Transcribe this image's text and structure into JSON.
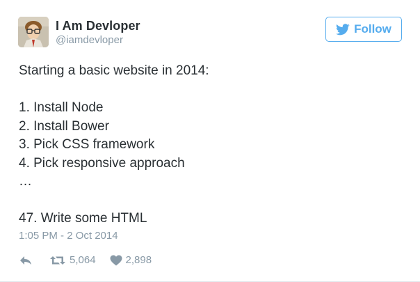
{
  "user": {
    "display_name": "I Am Devloper",
    "handle": "@iamdevloper"
  },
  "follow_button": {
    "label": "Follow",
    "icon": "twitter-bird-icon",
    "color": "#55acee"
  },
  "tweet": {
    "lines": [
      "Starting a basic website in 2014:",
      "",
      "1. Install Node",
      "2. Install Bower",
      "3. Pick CSS framework",
      "4. Pick responsive approach",
      "…",
      "",
      "47. Write some HTML"
    ],
    "timestamp": "1:05 PM - 2 Oct 2014"
  },
  "actions": {
    "reply_icon": "reply-icon",
    "retweet_icon": "retweet-icon",
    "retweet_count": "5,064",
    "like_icon": "heart-icon",
    "like_count": "2,898"
  },
  "colors": {
    "text": "#292f33",
    "muted": "#8899a6",
    "accent": "#55acee"
  }
}
